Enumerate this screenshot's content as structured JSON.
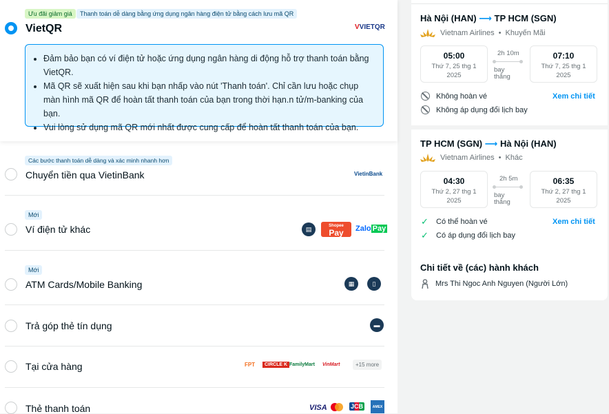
{
  "vietqr": {
    "tag_discount": "Ưu đãi giảm giá",
    "tag_desc": "Thanh toán dễ dàng bằng ứng dụng ngân hàng điện tử bằng cách lưu mã QR",
    "title": "VietQR",
    "logo_text": "VIETQR",
    "info": [
      "Đảm bảo bạn có ví điện tử hoặc ứng dụng ngân hàng di động hỗ trợ thanh toán bằng VietQR.",
      "Mã QR sẽ xuất hiện sau khi bạn nhấp vào nút 'Thanh toán'. Chỉ cần lưu hoặc chụp màn hình mã QR để hoàn tất thanh toán của bạn trong thời hạn.n tử/m-banking của bạn.",
      "Vui lòng sử dụng mã QR mới nhất được cung cấp để hoàn tất thanh toán của bạn."
    ]
  },
  "methods": {
    "vietin_tag": "Các bước thanh toán dễ dàng và xác minh nhanh hơn",
    "vietin": "Chuyển tiền qua VietinBank",
    "vietin_logo": "VietinBank",
    "new_tag": "Mới",
    "ewallet": "Ví điện tử khác",
    "shopeepay": "Pay",
    "shopee_small": "Shopee",
    "zalopay_a": "Zalo",
    "zalopay_b": "Pay",
    "atm": "ATM Cards/Mobile Banking",
    "installment": "Trả góp thẻ tín dụng",
    "store": "Tại cửa hàng",
    "store_logos": [
      "FPT",
      "CIRCLE K",
      "FamilyMart",
      "VinMart"
    ],
    "store_more": "+15 more",
    "card": "Thẻ thanh toán",
    "card_logos": [
      "VISA",
      "JCB",
      "AMEX"
    ]
  },
  "trip": {
    "out": {
      "from": "Hà Nội (HAN)",
      "to": "TP HCM (SGN)",
      "airline": "Vietnam Airlines",
      "fare": "Khuyến Mãi",
      "dep_time": "05:00",
      "dep_date": "Thứ 7, 25 thg 1 2025",
      "duration": "2h 10m",
      "stops": "bay thẳng",
      "arr_time": "07:10",
      "arr_date": "Thứ 7, 25 thg 1 2025",
      "cond1": "Không hoàn vé",
      "cond2": "Không áp dụng đổi lịch bay",
      "detail_link": "Xem chi tiết"
    },
    "ret": {
      "from": "TP HCM (SGN)",
      "to": "Hà Nội (HAN)",
      "airline": "Vietnam Airlines",
      "fare": "Khác",
      "dep_time": "04:30",
      "dep_date": "Thứ 2, 27 thg 1 2025",
      "duration": "2h 5m",
      "stops": "bay thẳng",
      "arr_time": "06:35",
      "arr_date": "Thứ 2, 27 thg 1 2025",
      "cond1": "Có thể hoàn vé",
      "cond2": "Có áp dụng đổi lịch bay",
      "detail_link": "Xem chi tiết"
    },
    "sep": "•",
    "passengers_title": "Chi tiết về (các) hành khách",
    "passenger": "Mrs Thi Ngoc Anh Nguyen (Người Lớn)"
  },
  "colors": {
    "accent": "#0194f3",
    "green": "#0bc175"
  }
}
